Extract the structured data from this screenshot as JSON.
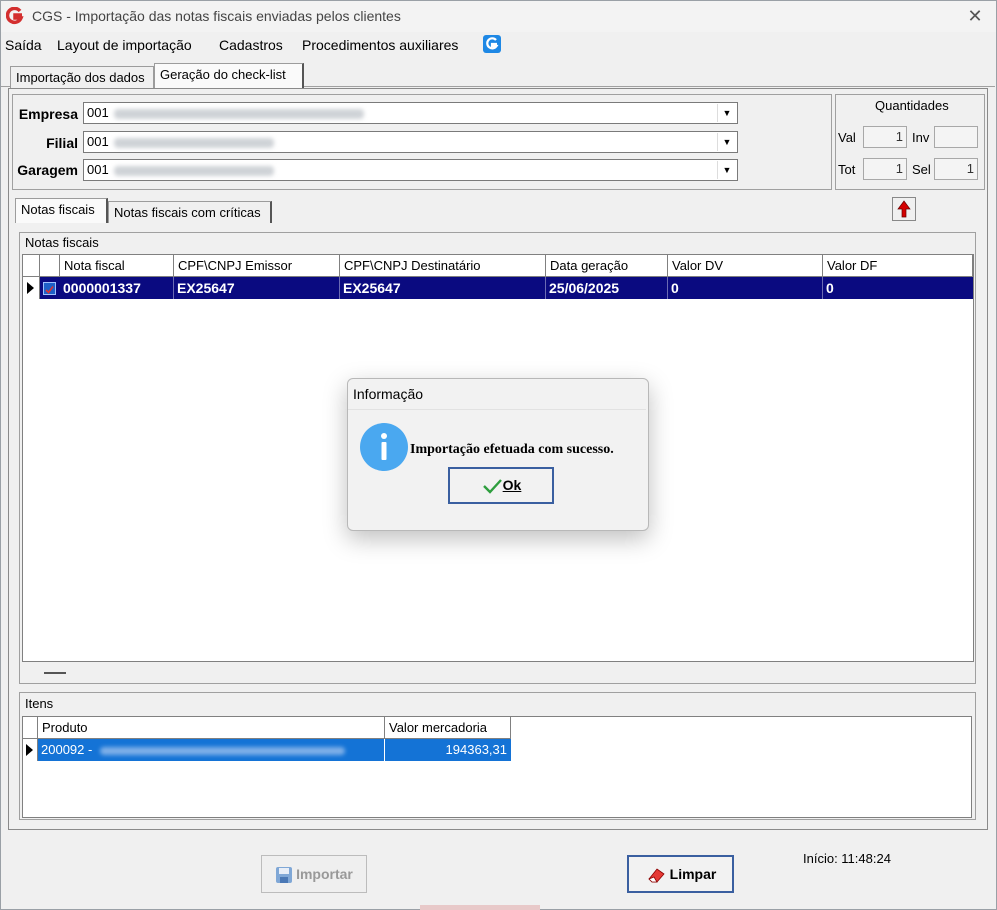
{
  "window": {
    "title": "CGS - Importação das notas fiscais enviadas pelos clientes",
    "logo_letter": "G",
    "close_glyph": "✕"
  },
  "menu": {
    "items": [
      "Saída",
      "Layout de importação",
      "Cadastros",
      "Procedimentos auxiliares"
    ],
    "icon": "cgs-logo-icon"
  },
  "top_tabs": [
    "Importação dos dados",
    "Geração do check-list"
  ],
  "filters": {
    "empresa": {
      "label": "Empresa",
      "code": "001"
    },
    "filial": {
      "label": "Filial",
      "code": "001"
    },
    "garagem": {
      "label": "Garagem",
      "code": "001"
    }
  },
  "quantidades": {
    "title": "Quantidades",
    "val_label": "Val",
    "val": "1",
    "inv_label": "Inv",
    "inv": "",
    "tot_label": "Tot",
    "tot": "1",
    "sel_label": "Sel",
    "sel": "1"
  },
  "inner_tabs": [
    "Notas fiscais",
    "Notas fiscais com críticas"
  ],
  "notas": {
    "group_title": "Notas fiscais",
    "columns": [
      "Nota fiscal",
      "CPF\\CNPJ Emissor",
      "CPF\\CNPJ Destinatário",
      "Data geração",
      "Valor DV",
      "Valor DF"
    ],
    "rows": [
      [
        "0000001337",
        "EX25647",
        "EX25647",
        "25/06/2025",
        "0",
        "0"
      ]
    ]
  },
  "itens": {
    "group_title": "Itens",
    "columns": [
      "Produto",
      "Valor mercadoria"
    ],
    "rows": [
      [
        "200092 -",
        "194363,31"
      ]
    ]
  },
  "dialog": {
    "title": "Informação",
    "message": "Importação efetuada com sucesso.",
    "ok_label": "Ok"
  },
  "footer": {
    "importar_label": "Importar",
    "limpar_label": "Limpar",
    "inicio": "Início: 11:48:24"
  },
  "colors": {
    "selection": "#0a0a80",
    "item_selection": "#1473d6",
    "info_icon": "#4aa8f0",
    "logo_red": "#d32f2f",
    "arrow_red": "#d40000"
  }
}
